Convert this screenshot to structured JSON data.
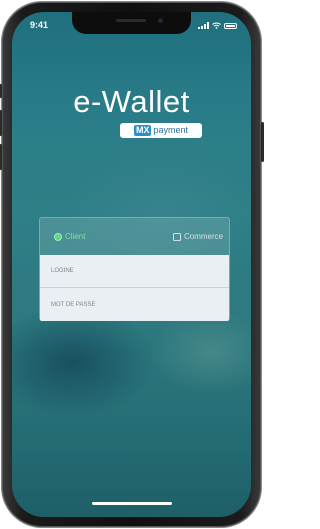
{
  "status_bar": {
    "time": "9:41",
    "icons": [
      "signal-icon",
      "wifi-icon",
      "battery-icon"
    ]
  },
  "app": {
    "title": "e-Wallet",
    "brand_mx": "MX",
    "brand_text": "payment",
    "brand_color": "#2d8fc7"
  },
  "login": {
    "account_types": [
      {
        "label": "Client",
        "selected": true
      },
      {
        "label": "Commerce",
        "selected": false
      }
    ],
    "login_placeholder": "LOGINE",
    "password_placeholder": "MOT DE PASSE"
  }
}
